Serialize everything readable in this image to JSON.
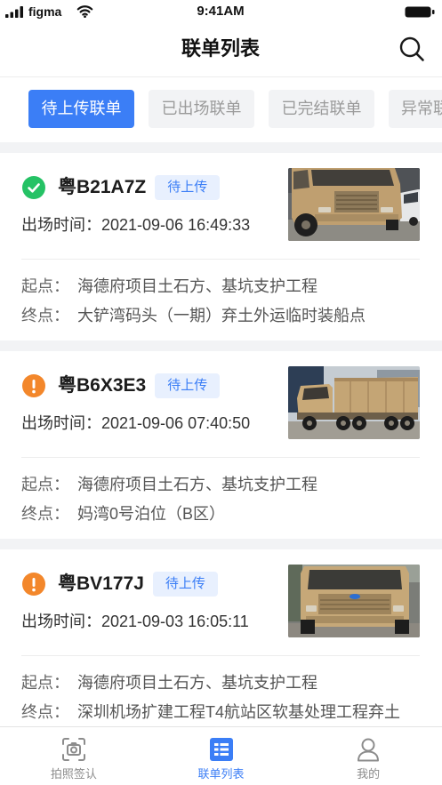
{
  "status_bar": {
    "carrier": "figma",
    "time": "9:41AM",
    "signal_icon": "signal-icon",
    "wifi_icon": "wifi-icon",
    "battery_icon": "battery-icon"
  },
  "header": {
    "title": "联单列表",
    "search_icon": "search-icon"
  },
  "tabs": [
    {
      "label": "待上传联单",
      "active": true
    },
    {
      "label": "已出场联单",
      "active": false
    },
    {
      "label": "已完结联单",
      "active": false
    },
    {
      "label": "异常联单",
      "active": false
    }
  ],
  "cards": [
    {
      "status_icon": "check-circle-icon",
      "plate": "粤B21A7Z",
      "badge": "待上传",
      "exit_label": "出场时间：",
      "exit_time": "2021-09-06 16:49:33",
      "start_label": "起点：",
      "start": "海德府项目土石方、基坑支护工程",
      "end_label": "终点：",
      "end": "大铲湾码头（一期）弃土外运临时装船点",
      "photo": "dump-truck-photo"
    },
    {
      "status_icon": "exclamation-circle-icon",
      "plate": "粤B6X3E3",
      "badge": "待上传",
      "exit_label": "出场时间：",
      "exit_time": "2021-09-06 07:40:50",
      "start_label": "起点：",
      "start": "海德府项目土石方、基坑支护工程",
      "end_label": "终点：",
      "end": "妈湾0号泊位（B区）",
      "photo": "dump-truck-photo"
    },
    {
      "status_icon": "exclamation-circle-icon",
      "plate": "粤BV177J",
      "badge": "待上传",
      "exit_label": "出场时间：",
      "exit_time": "2021-09-03 16:05:11",
      "start_label": "起点：",
      "start": "海德府项目土石方、基坑支护工程",
      "end_label": "终点：",
      "end": "深圳机场扩建工程T4航站区软基处理工程弃土",
      "photo": "dump-truck-photo"
    }
  ],
  "bottom_nav": [
    {
      "label": "拍照签认",
      "icon": "camera-scan-icon",
      "active": false
    },
    {
      "label": "联单列表",
      "icon": "list-icon",
      "active": true
    },
    {
      "label": "我的",
      "icon": "user-icon",
      "active": false
    }
  ],
  "colors": {
    "accent": "#3b7ef6",
    "success": "#25c265",
    "warning": "#f3872b",
    "page_bg": "#f2f3f5",
    "badge_bg": "#e8f0fe"
  }
}
